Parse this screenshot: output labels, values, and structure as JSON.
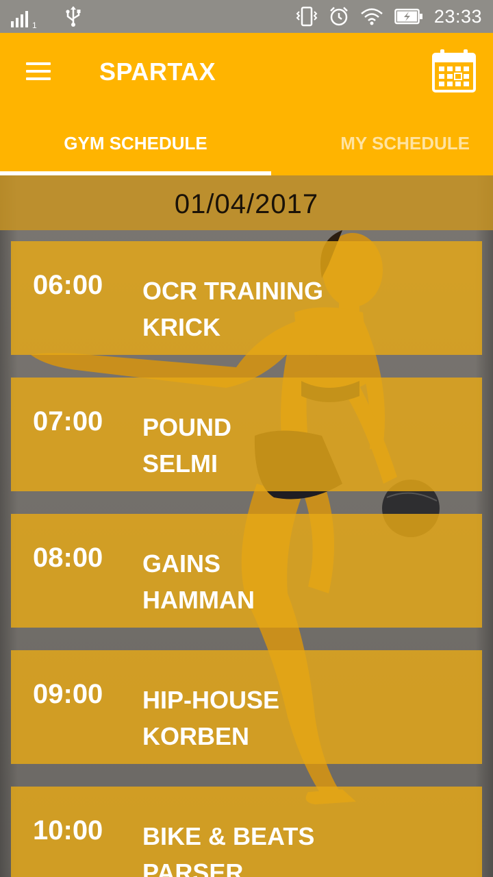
{
  "status_bar": {
    "sim_label": "1",
    "time": "23:33",
    "icons": [
      "signal-icon",
      "usb-icon",
      "vibrate-icon",
      "alarm-icon",
      "wifi-icon",
      "battery-charging-icon"
    ]
  },
  "app_bar": {
    "title": "SPARTAX",
    "menu_icon": "hamburger-menu-icon",
    "calendar_icon": "calendar-icon",
    "color": "#ffb400"
  },
  "tabs": [
    {
      "label": "GYM SCHEDULE",
      "selected": true
    },
    {
      "label": "MY SCHEDULE",
      "selected": false
    }
  ],
  "schedule": {
    "date": "01/04/2017",
    "classes": [
      {
        "time": "06:00",
        "name": "OCR TRAINING",
        "instructor": "KRICK"
      },
      {
        "time": "07:00",
        "name": "POUND",
        "instructor": "SELMI"
      },
      {
        "time": "08:00",
        "name": "GAINS",
        "instructor": "HAMMAN"
      },
      {
        "time": "09:00",
        "name": "HIP-HOUSE",
        "instructor": "KORBEN"
      },
      {
        "time": "10:00",
        "name": "BIKE & BEATS",
        "instructor": "PARSER"
      }
    ]
  }
}
